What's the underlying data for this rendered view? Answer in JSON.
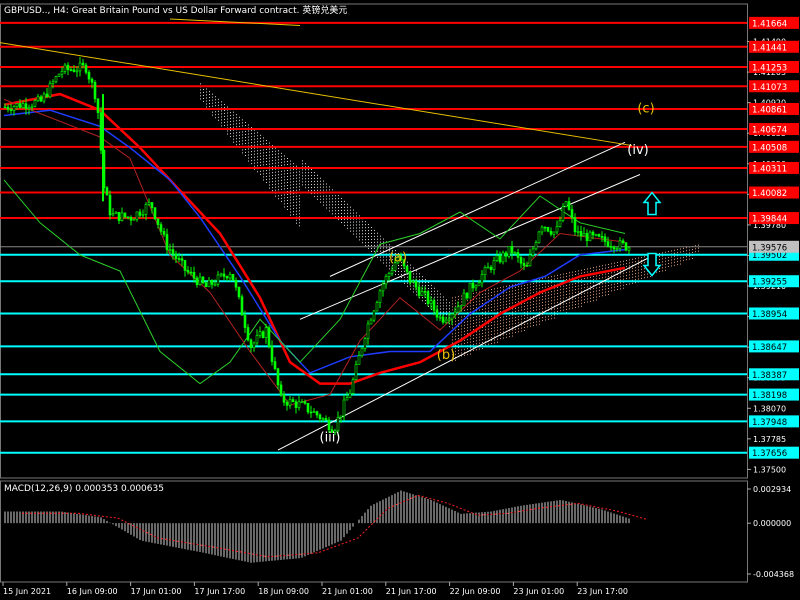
{
  "header": {
    "title": "GBPUSD.., H4: Great Britain Pound vs US Dollar Forward contract. 英镑兑美元"
  },
  "macd": {
    "label": "MACD(12,26,9) 0.000353 0.000635",
    "scale": [
      "0.002934",
      "0.000000",
      "-0.004368"
    ]
  },
  "colors": {
    "background": "#000000",
    "candle": "#00ff00",
    "resistance": "#ff0000",
    "support": "#00ffff",
    "trend": "#e8c000",
    "wave_white": "#ffffff",
    "wave_yellow": "#e8c000",
    "ma_red": "#ff0000",
    "ma_blue": "#1e3cff",
    "arrow": "#00ffff"
  },
  "price_axis": {
    "ticks": [
      "1.41490",
      "1.41205",
      "1.40920",
      "1.40635",
      "1.40350",
      "1.40065",
      "1.39780",
      "1.39495",
      "1.39210",
      "1.38925",
      "1.38640",
      "1.38355",
      "1.38070",
      "1.37785",
      "1.37500"
    ],
    "current": "1.39576",
    "levels": [
      {
        "label": "1.41664",
        "kind": "resistance"
      },
      {
        "label": "1.41441",
        "kind": "resistance"
      },
      {
        "label": "1.41253",
        "kind": "resistance"
      },
      {
        "label": "1.41073",
        "kind": "resistance"
      },
      {
        "label": "1.40861",
        "kind": "resistance"
      },
      {
        "label": "1.40674",
        "kind": "resistance"
      },
      {
        "label": "1.40508",
        "kind": "resistance"
      },
      {
        "label": "1.40311",
        "kind": "resistance"
      },
      {
        "label": "1.40082",
        "kind": "resistance"
      },
      {
        "label": "1.39844",
        "kind": "resistance"
      },
      {
        "label": "1.39502",
        "kind": "support"
      },
      {
        "label": "1.39255",
        "kind": "support"
      },
      {
        "label": "1.38954",
        "kind": "support"
      },
      {
        "label": "1.38647",
        "kind": "support"
      },
      {
        "label": "1.38387",
        "kind": "support"
      },
      {
        "label": "1.38198",
        "kind": "support"
      },
      {
        "label": "1.37948",
        "kind": "support"
      },
      {
        "label": "1.37656",
        "kind": "support"
      }
    ]
  },
  "time_axis": [
    "15 Jun 2021",
    "16 Jun 09:00",
    "17 Jun 01:00",
    "17 Jun 17:00",
    "18 Jun 09:00",
    "21 Jun 01:00",
    "21 Jun 17:00",
    "22 Jun 09:00",
    "23 Jun 01:00",
    "23 Jun 17:00"
  ],
  "waves": [
    {
      "label": "(iii)",
      "color": "white"
    },
    {
      "label": "(a)",
      "color": "yellow"
    },
    {
      "label": "(b)",
      "color": "yellow"
    },
    {
      "label": "(iv)",
      "color": "white"
    },
    {
      "label": "(c)",
      "color": "yellow"
    }
  ],
  "arrows": [
    {
      "direction": "up",
      "icon": "arrow-up-icon"
    },
    {
      "direction": "down",
      "icon": "arrow-down-icon"
    }
  ]
}
